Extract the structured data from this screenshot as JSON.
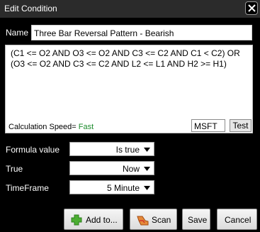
{
  "window": {
    "title": "Edit Condition"
  },
  "name": {
    "label": "Name",
    "value": "Three Bar Reversal Pattern - Bearish"
  },
  "formula": {
    "text": "(C1 <= O2 AND O3 <= O2 AND C3 <= C2 AND C1 < C2) OR (O3 <= O2 AND C3 <= C2 AND L2 <= L1 AND H2 >= H1)",
    "calc_label": "Calculation Speed=",
    "calc_value": "Fast",
    "symbol": "MSFT",
    "test_label": "Test"
  },
  "fields": {
    "formula_value": {
      "label": "Formula value",
      "value": "Is true"
    },
    "true": {
      "label": "True",
      "value": "Now"
    },
    "timeframe": {
      "label": "TimeFrame",
      "value": "5 Minute"
    }
  },
  "buttons": {
    "add": "Add to...",
    "scan": "Scan",
    "save": "Save",
    "cancel": "Cancel"
  },
  "colors": {
    "background": "#000000",
    "calc_speed_fast": "#1a8a2a",
    "add_icon": "#4cae32"
  },
  "icons": [
    "close-icon",
    "add-icon",
    "scan-icon",
    "dropdown-arrow-icon"
  ]
}
